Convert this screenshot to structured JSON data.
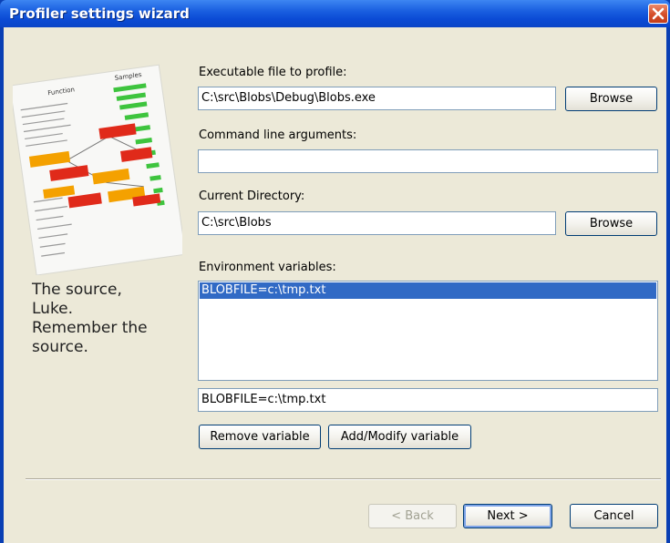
{
  "window": {
    "title": "Profiler settings wizard"
  },
  "left": {
    "tagline": [
      "The source,",
      "Luke.",
      "Remember the",
      "source."
    ],
    "illustration": {
      "header_function": "Function",
      "header_samples": "Samples"
    }
  },
  "form": {
    "executable_label": "Executable file to profile:",
    "executable_value": "C:\\src\\Blobs\\Debug\\Blobs.exe",
    "args_label": "Command line arguments:",
    "args_value": "",
    "cwd_label": "Current Directory:",
    "cwd_value": "C:\\src\\Blobs",
    "env_label": "Environment variables:",
    "env_list": [
      {
        "text": "BLOBFILE=c:\\tmp.txt",
        "selected": true
      }
    ],
    "env_edit_value": "BLOBFILE=c:\\tmp.txt",
    "browse_label": "Browse",
    "remove_label": "Remove variable",
    "addmod_label": "Add/Modify variable"
  },
  "footer": {
    "back_label": "< Back",
    "next_label": "Next >",
    "cancel_label": "Cancel"
  },
  "colors": {
    "titlebar": "#0b4bd5",
    "dialog_bg": "#ece9d8",
    "selection": "#316ac5",
    "close_button": "#d54e2a"
  }
}
